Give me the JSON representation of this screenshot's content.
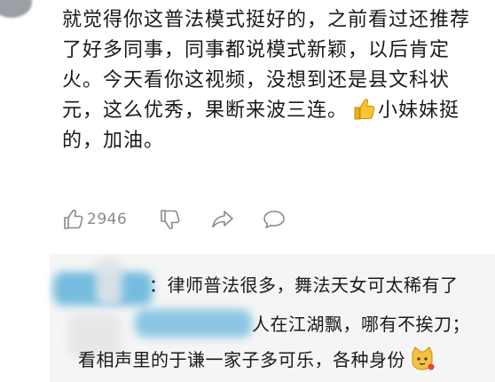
{
  "comment": {
    "lines": [
      "就觉得你这普法模式挺好的，之前看过还推荐",
      "了好多同事，同事都说模式新颖，以后肯定",
      "火。今天看你这视频，没想到还是县文科状",
      "元，这么优秀，果断来波三连。",
      "的，加油。"
    ],
    "line4_tail": "小妹妹挺",
    "inline_emoji": "thumbs-up-icon"
  },
  "actions": {
    "like_count": "2946",
    "icons": [
      "thumb-up-icon",
      "thumb-down-icon",
      "share-icon",
      "reply-icon"
    ]
  },
  "replies": [
    {
      "text": "：律师普法很多，舞法天女可太稀有了"
    },
    {
      "text": "人在江湖飘，哪有不挨刀；"
    },
    {
      "text": "看相声里的于谦一家子多可乐，各种身份",
      "emoji": "cat-face-icon"
    }
  ],
  "colors": {
    "text": "#1a1a1a",
    "muted": "#8a8a8a",
    "reply_bg": "#f5f5f5",
    "blur_accent": "#4aa9d8"
  }
}
